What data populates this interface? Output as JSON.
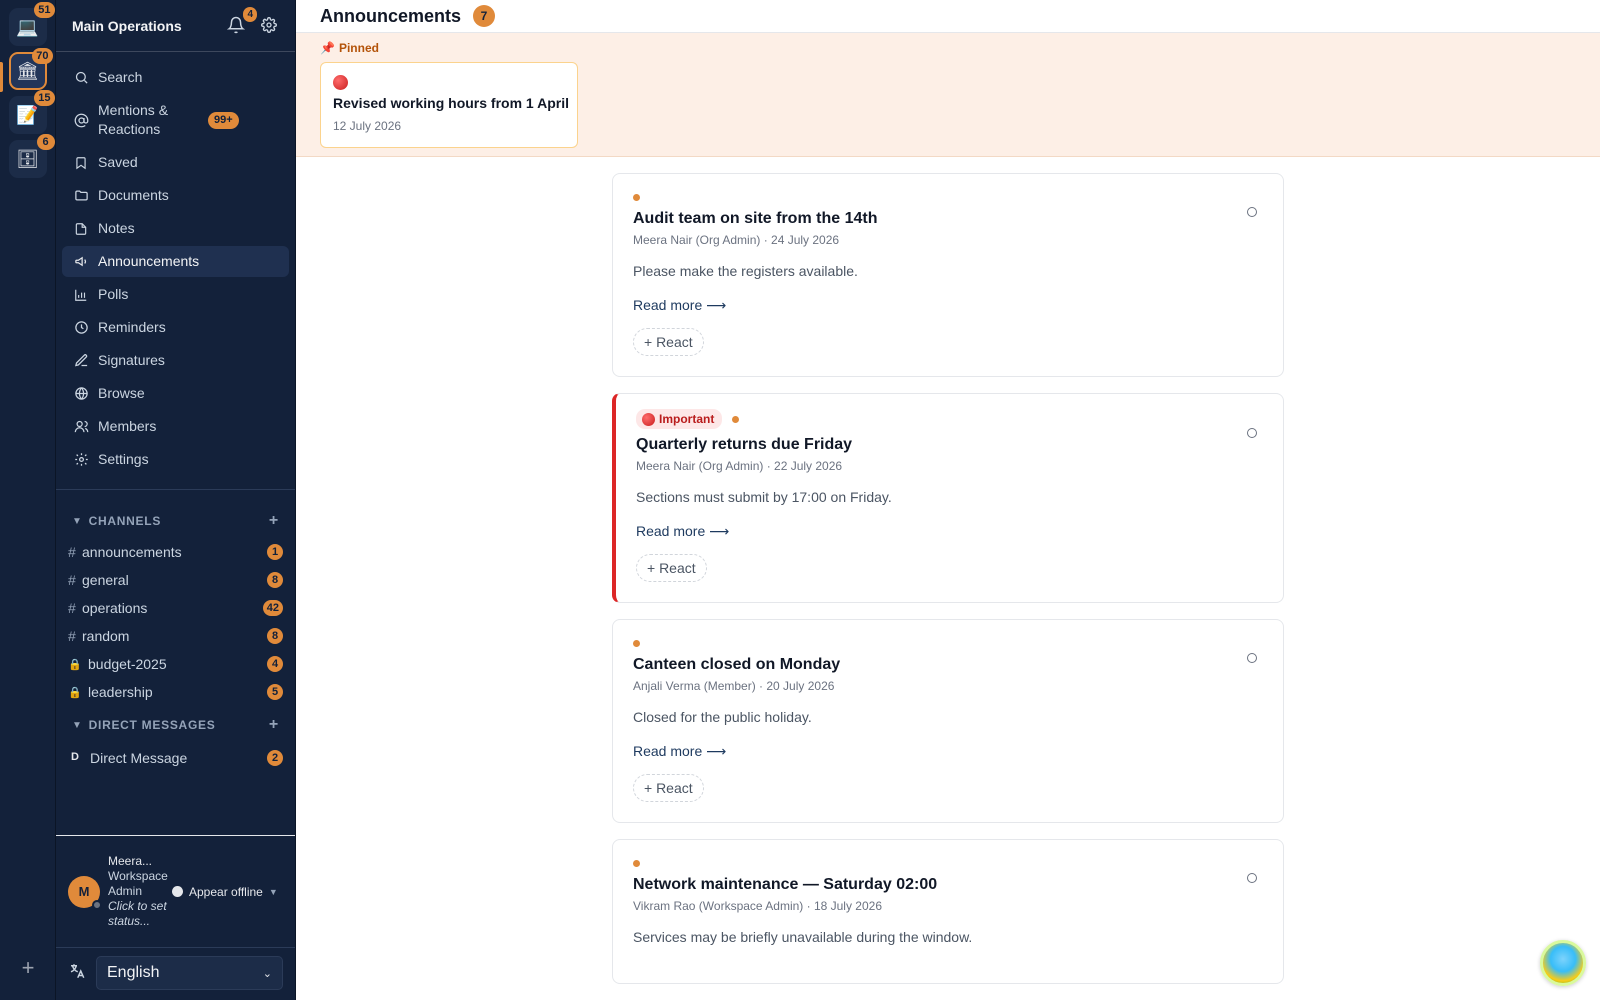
{
  "workspaces": [
    {
      "icon": "laptop-icon",
      "glyph": "💻",
      "badge": "51"
    },
    {
      "icon": "bank-icon",
      "glyph": "🏛",
      "badge": "70"
    },
    {
      "icon": "notepad-icon",
      "glyph": "📝",
      "badge": "15"
    },
    {
      "icon": "cabinet-icon",
      "glyph": "🗄",
      "badge": "6"
    }
  ],
  "sidebar": {
    "title": "Main Operations",
    "notif_count": "4",
    "nav": [
      {
        "label": "Search",
        "icon": "search-icon"
      },
      {
        "label": "Mentions & Reactions",
        "icon": "at-icon",
        "badge": "99+"
      },
      {
        "label": "Saved",
        "icon": "bookmark-icon"
      },
      {
        "label": "Documents",
        "icon": "folder-icon"
      },
      {
        "label": "Notes",
        "icon": "note-icon"
      },
      {
        "label": "Announcements",
        "icon": "megaphone-icon"
      },
      {
        "label": "Polls",
        "icon": "chart-icon"
      },
      {
        "label": "Reminders",
        "icon": "clock-icon"
      },
      {
        "label": "Signatures",
        "icon": "pen-icon"
      },
      {
        "label": "Browse",
        "icon": "globe-icon"
      },
      {
        "label": "Members",
        "icon": "users-icon"
      },
      {
        "label": "Settings",
        "icon": "gear-icon"
      }
    ],
    "channels_heading": "CHANNELS",
    "channels": [
      {
        "prefix": "#",
        "name": "announcements",
        "count": "1"
      },
      {
        "prefix": "#",
        "name": "general",
        "count": "8"
      },
      {
        "prefix": "#",
        "name": "operations",
        "count": "42"
      },
      {
        "prefix": "#",
        "name": "random",
        "count": "8"
      },
      {
        "prefix": "🔒",
        "name": "budget-2025",
        "count": "4"
      },
      {
        "prefix": "🔒",
        "name": "leadership",
        "count": "5"
      }
    ],
    "dm_heading": "DIRECT MESSAGES",
    "dms": [
      {
        "initial": "D",
        "name": "Direct Message",
        "count": "2"
      }
    ],
    "user": {
      "initial": "M",
      "name": "Meera...",
      "role": "Workspace Admin",
      "status": "Click to set status...",
      "presence": "Appear offline"
    },
    "language": "English"
  },
  "header": {
    "title": "Announcements",
    "count": "7"
  },
  "pinned": {
    "label": "Pinned",
    "title": "Revised working hours from 1 April",
    "date": "12 July 2026"
  },
  "announcements": [
    {
      "title": "Audit team on site from the 14th",
      "byline": "Meera Nair (Org Admin) · 24 July 2026",
      "body": "Please make the registers available.",
      "important": false
    },
    {
      "title": "Quarterly returns due Friday",
      "byline": "Meera Nair (Org Admin) · 22 July 2026",
      "body": "Sections must submit by 17:00 on Friday.",
      "important": true,
      "badge": "Important"
    },
    {
      "title": "Canteen closed on Monday",
      "byline": "Anjali Verma (Member) · 20 July 2026",
      "body": "Closed for the public holiday.",
      "important": false
    },
    {
      "title": "Network maintenance — Saturday 02:00",
      "byline": "Vikram Rao (Workspace Admin) · 18 July 2026",
      "body": "Services may be briefly unavailable during the window.",
      "important": false
    }
  ],
  "labels": {
    "read_more": "Read more ⟶",
    "react": "+ React"
  },
  "colors": {
    "accent": "#e08a3a",
    "sidebar_bg": "#13213a",
    "important": "#dc2626",
    "pinned_bg": "#fdefe6"
  }
}
